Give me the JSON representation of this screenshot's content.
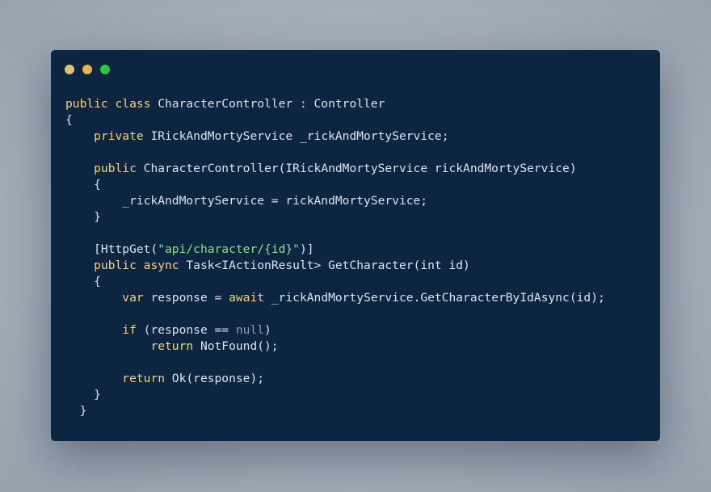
{
  "window": {
    "controls": [
      "close",
      "minimize",
      "maximize"
    ],
    "colors": {
      "background": "#0c2541",
      "keyword": "#f6d37a",
      "string": "#8fe08a",
      "null_literal": "#8d9aa8",
      "text": "#dbe4ee"
    }
  },
  "code": {
    "language": "csharp",
    "lines": [
      [
        {
          "k": "kw",
          "t": "public class"
        },
        {
          "k": "txt",
          "t": " CharacterController : Controller"
        }
      ],
      [
        {
          "k": "txt",
          "t": "{"
        }
      ],
      [
        {
          "k": "txt",
          "t": "    "
        },
        {
          "k": "kw",
          "t": "private"
        },
        {
          "k": "txt",
          "t": " IRickAndMortyService _rickAndMortyService;"
        }
      ],
      [],
      [
        {
          "k": "txt",
          "t": "    "
        },
        {
          "k": "kw",
          "t": "public"
        },
        {
          "k": "txt",
          "t": " CharacterController(IRickAndMortyService rickAndMortyService)"
        }
      ],
      [
        {
          "k": "txt",
          "t": "    {"
        }
      ],
      [
        {
          "k": "txt",
          "t": "        _rickAndMortyService = rickAndMortyService;"
        }
      ],
      [
        {
          "k": "txt",
          "t": "    }"
        }
      ],
      [],
      [
        {
          "k": "txt",
          "t": "    [HttpGet("
        },
        {
          "k": "str",
          "t": "\"api/character/{id}\""
        },
        {
          "k": "txt",
          "t": ")]"
        }
      ],
      [
        {
          "k": "txt",
          "t": "    "
        },
        {
          "k": "kw",
          "t": "public async"
        },
        {
          "k": "txt",
          "t": " Task<IActionResult> GetCharacter(int id)"
        }
      ],
      [
        {
          "k": "txt",
          "t": "    {"
        }
      ],
      [
        {
          "k": "txt",
          "t": "        "
        },
        {
          "k": "kw",
          "t": "var"
        },
        {
          "k": "txt",
          "t": " response = "
        },
        {
          "k": "kw",
          "t": "await"
        },
        {
          "k": "txt",
          "t": " _rickAndMortyService.GetCharacterByIdAsync(id);"
        }
      ],
      [],
      [
        {
          "k": "txt",
          "t": "        "
        },
        {
          "k": "kw",
          "t": "if"
        },
        {
          "k": "txt",
          "t": " (response == "
        },
        {
          "k": "nul",
          "t": "null"
        },
        {
          "k": "txt",
          "t": ")"
        }
      ],
      [
        {
          "k": "txt",
          "t": "            "
        },
        {
          "k": "kw",
          "t": "return"
        },
        {
          "k": "txt",
          "t": " NotFound();"
        }
      ],
      [],
      [
        {
          "k": "txt",
          "t": "        "
        },
        {
          "k": "kw",
          "t": "return"
        },
        {
          "k": "txt",
          "t": " Ok(response);"
        }
      ],
      [
        {
          "k": "txt",
          "t": "    }"
        }
      ],
      [
        {
          "k": "txt",
          "t": "  }"
        }
      ]
    ]
  }
}
